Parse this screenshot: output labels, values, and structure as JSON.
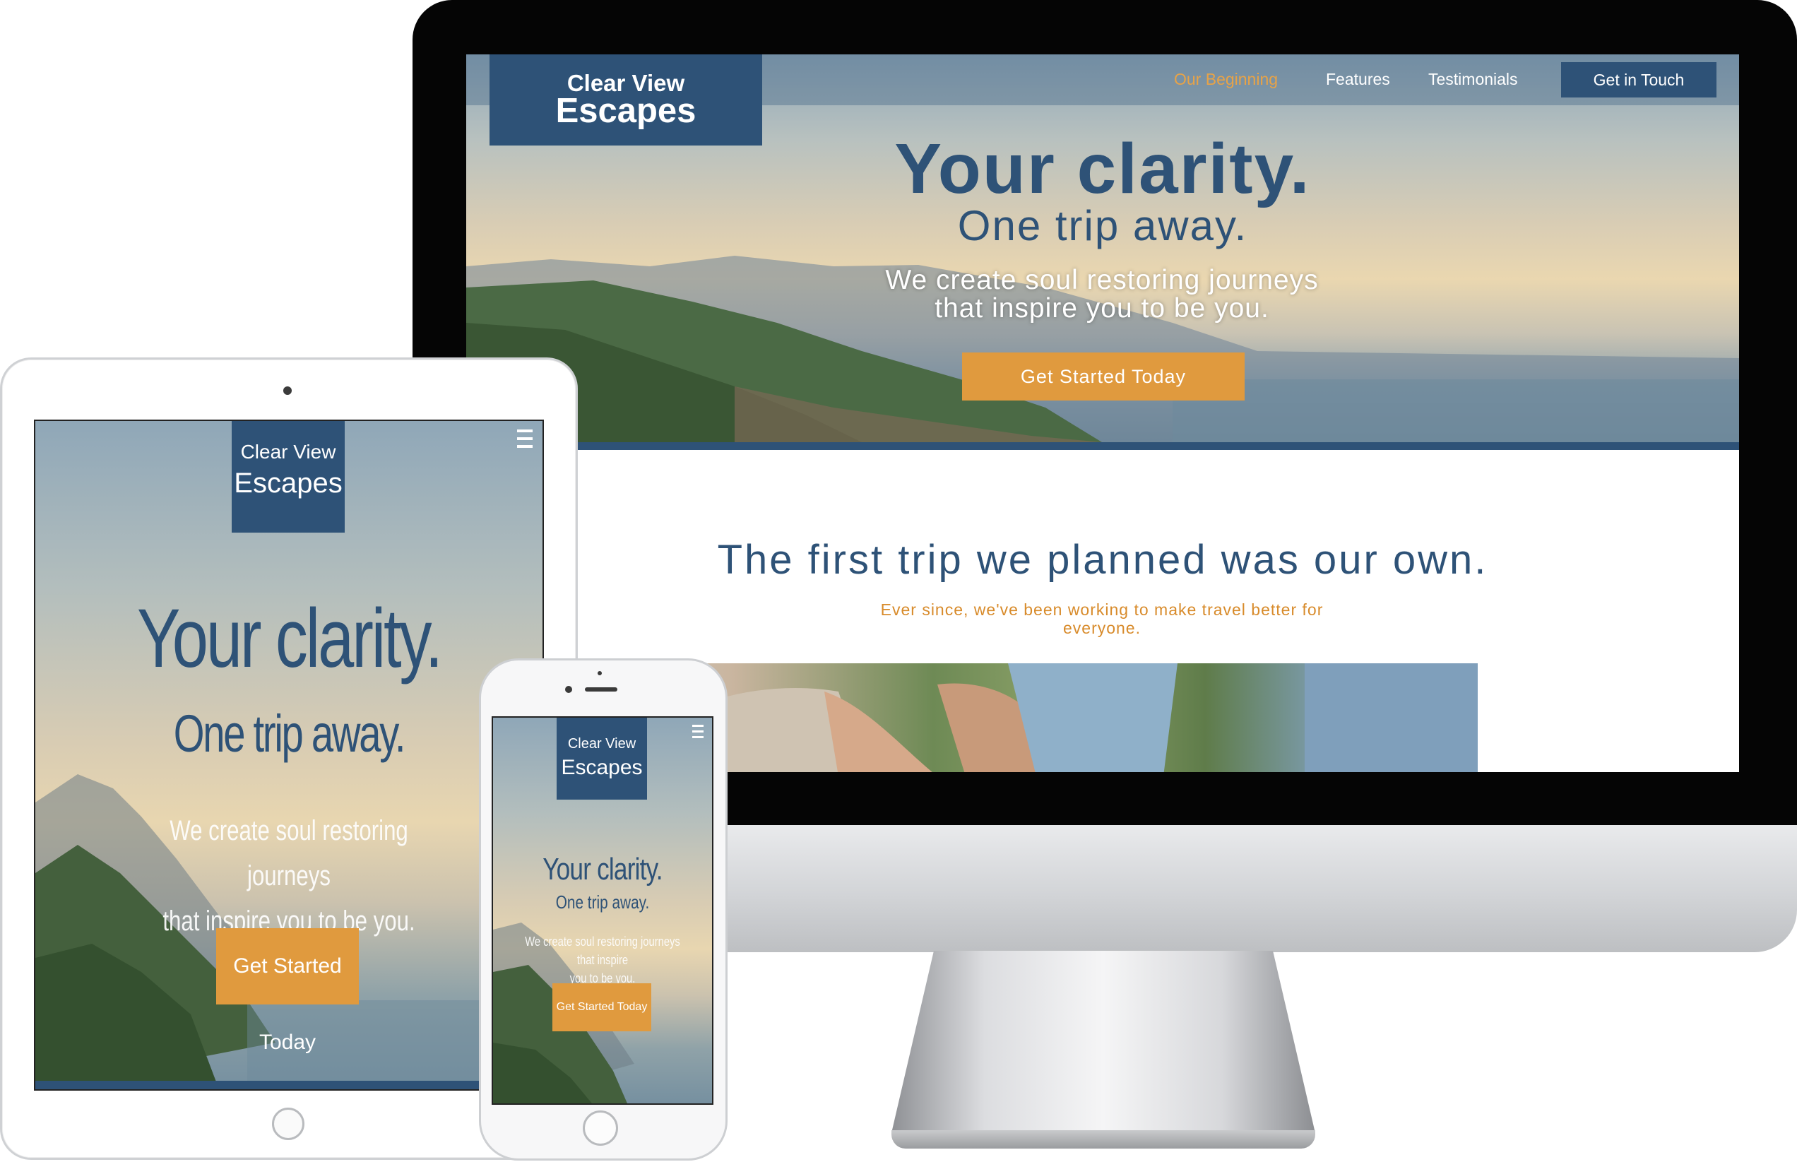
{
  "brand": {
    "line1": "Clear View",
    "line2": "Escapes"
  },
  "desktop": {
    "nav": [
      {
        "label": "Our Beginning",
        "active": true
      },
      {
        "label": "Features",
        "active": false
      },
      {
        "label": "Testimonials",
        "active": false
      }
    ],
    "nav_cta": "Get in Touch",
    "hero": {
      "title": "Your clarity.",
      "subtitle": "One trip away.",
      "tagline_line1": "We create soul restoring journeys",
      "tagline_line2": "that inspire you to be you.",
      "cta": "Get Started Today"
    },
    "section": {
      "title": "The first trip we planned was our own.",
      "subtitle_line1": "Ever since, we've been working to make travel better for",
      "subtitle_line2": "everyone."
    }
  },
  "tablet": {
    "hero": {
      "title": "Your clarity.",
      "subtitle": "One trip away.",
      "tagline_line1": "We create soul restoring journeys",
      "tagline_line2": "that inspire you to be you.",
      "cta": "Get Started Today"
    }
  },
  "phone": {
    "hero": {
      "title": "Your clarity.",
      "subtitle": "One trip away.",
      "tagline_line1": "We create soul restoring journeys that inspire",
      "tagline_line2": "you to be you.",
      "cta": "Get Started Today"
    }
  },
  "colors": {
    "brand_blue": "#2e5277",
    "accent_orange": "#e09a3e",
    "active_nav": "#e8a347"
  },
  "icons": {
    "mobile_menu": "hamburger-menu-icon"
  }
}
